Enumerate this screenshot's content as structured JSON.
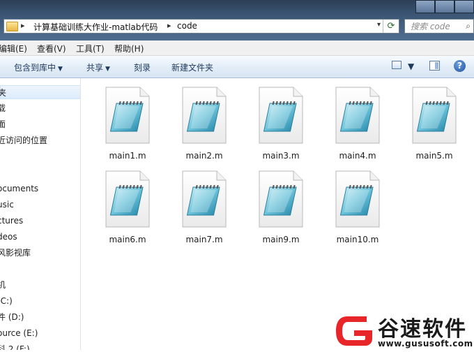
{
  "address_bar": {
    "crumbs": [
      "计算基础训练大作业-matlab代码",
      "code"
    ]
  },
  "search": {
    "placeholder": "搜索 code"
  },
  "menu": {
    "items": [
      "编辑(E)",
      "查看(V)",
      "工具(T)",
      "帮助(H)"
    ]
  },
  "toolbar": {
    "include_library": "包含到库中",
    "share": "共享",
    "burn": "刻录",
    "new_folder": "新建文件夹"
  },
  "nav": {
    "items": [
      "夹",
      "载",
      "面",
      "近访问的位置",
      "ocuments",
      "usic",
      "ctures",
      "deos",
      "风影视库",
      "机",
      "(C:)",
      "件 (D:)",
      "ource (E:)",
      "科 2 (F:)"
    ],
    "selected_index": 0
  },
  "files": [
    {
      "name": "main1.m"
    },
    {
      "name": "main2.m"
    },
    {
      "name": "main3.m"
    },
    {
      "name": "main4.m"
    },
    {
      "name": "main5.m"
    },
    {
      "name": "main6.m"
    },
    {
      "name": "main7.m"
    },
    {
      "name": "main9.m"
    },
    {
      "name": "main10.m"
    }
  ],
  "watermark": {
    "brand": "谷速软件",
    "url": "www.gususoft.com",
    "color": "#e8262a"
  }
}
